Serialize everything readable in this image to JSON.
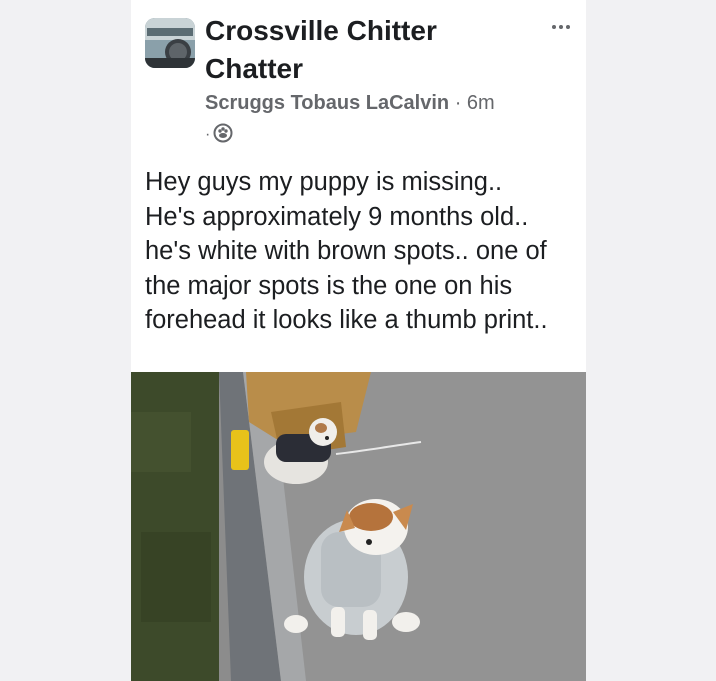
{
  "post": {
    "group_name": "Crossville Chitter Chatter",
    "author": "Scruggs Tobaus LaCalvin",
    "separator": "·",
    "time": "6m",
    "privacy_icon": "group-icon",
    "more_icon": "more-options-icon",
    "text": "Hey guys my puppy is missing..\nHe's approximately 9 months old.. he's white with brown spots.. one of the major spots is the one on his forehead it looks like a thumb print..",
    "photo_subject": "two-puppies-on-pavement"
  }
}
